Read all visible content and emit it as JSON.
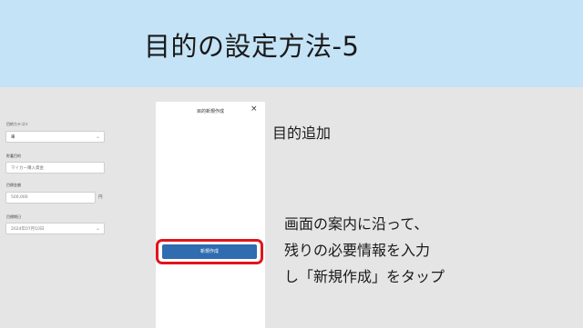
{
  "slide": {
    "title": "目的の設定方法-5",
    "step_title": "目的追加",
    "instructions": [
      "画面の案内に沿って、",
      "残りの必要情報を入力",
      "し「新規作成」をタップ"
    ]
  },
  "phone": {
    "title": "目的新規作成",
    "close_icon": "×",
    "fields": [
      {
        "label": "目的カテゴリ",
        "value": "車"
      },
      {
        "label": "貯蓄目的",
        "value": "マイカー購入資金"
      },
      {
        "label": "目標金額",
        "value": "500,000",
        "unit": "円"
      },
      {
        "label": "目標期日",
        "value": "2024年07月10日"
      }
    ],
    "create_button": "新規作成"
  }
}
